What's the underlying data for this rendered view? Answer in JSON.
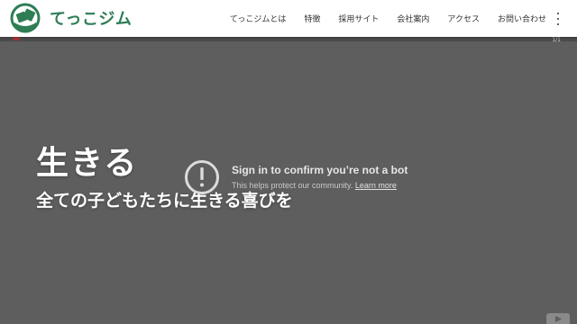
{
  "header": {
    "logo_text": "てっこジム",
    "nav": [
      {
        "label": "てっこジムとは"
      },
      {
        "label": "特徴"
      },
      {
        "label": "採用サイト"
      },
      {
        "label": "会社案内"
      },
      {
        "label": "アクセス"
      },
      {
        "label": "お問い合わせ"
      }
    ],
    "menu_icon": "kebab-menu-icon"
  },
  "video": {
    "counter": "1/1",
    "overlay": {
      "title": "Sign in to confirm you’re not a bot",
      "subtitle": "This helps protect our community.",
      "link": "Learn more",
      "icon": "alert-circle-icon"
    },
    "logo_icon": "youtube-icon"
  },
  "hero": {
    "title": "生きる",
    "subtitle": "全ての子どもたちに生きる喜びを"
  },
  "colors": {
    "brand": "#2e7d55",
    "video_bg": "#5f5f5f",
    "header_bg": "#ffffff"
  }
}
